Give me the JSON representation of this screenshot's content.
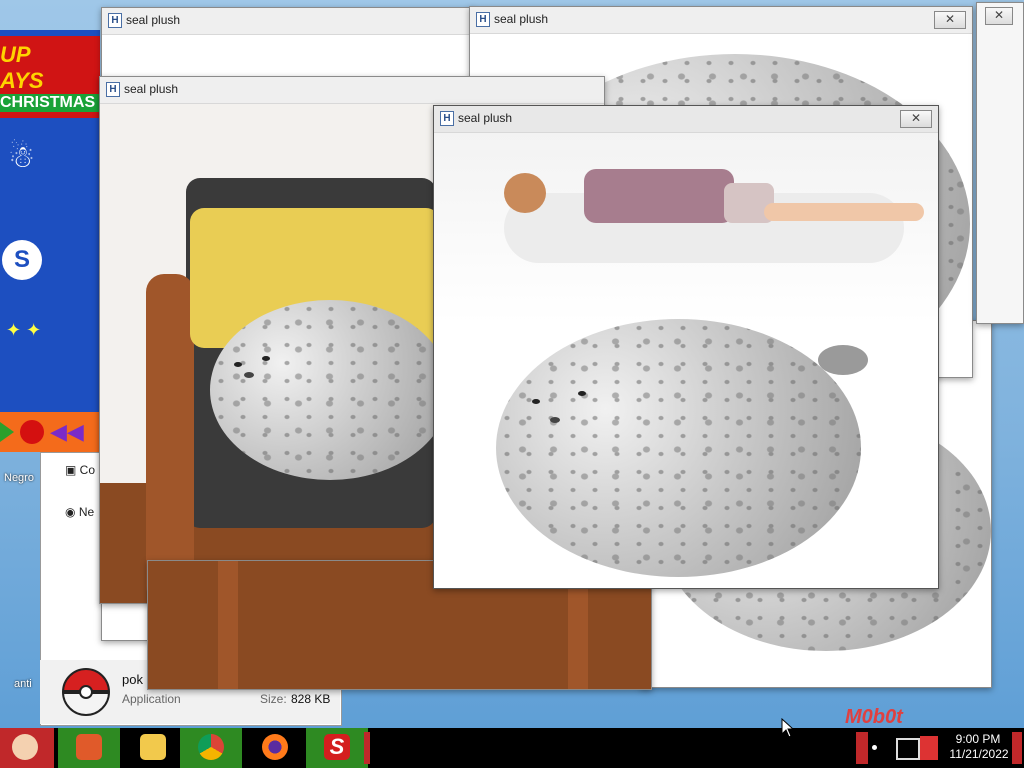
{
  "windows": [
    {
      "title": "seal plush",
      "close": "✕"
    },
    {
      "title": "seal plush",
      "close": "✕"
    },
    {
      "title": "seal plush",
      "close": "✕"
    },
    {
      "title": "seal plush",
      "close": "✕"
    }
  ],
  "background_app": {
    "header_line1": "UP",
    "header_line2": "AYS",
    "header_banner": "CHRISTMAS"
  },
  "explorer": {
    "row1": "Co",
    "row2": "Ne",
    "status": {
      "name": "pok",
      "type": "Application",
      "size_label": "Size:",
      "size_value": "828 KB"
    }
  },
  "desktop_icons": [
    {
      "label": "Negro"
    },
    {
      "label": "anti"
    }
  ],
  "watermark": "M0b0t",
  "taskbar": {
    "buttons": [
      {
        "icon": "santa-start-icon"
      },
      {
        "icon": "folder-icon"
      },
      {
        "icon": "media-player-icon"
      },
      {
        "icon": "chrome-icon"
      },
      {
        "icon": "firefox-icon"
      },
      {
        "icon": "s-app-icon"
      }
    ],
    "time": "9:00 PM",
    "date": "11/21/2022"
  },
  "colors": {
    "taskbar_bg": "#000000",
    "taskbar_button": "#2e8a22",
    "desktop": "#7fb2dd"
  }
}
